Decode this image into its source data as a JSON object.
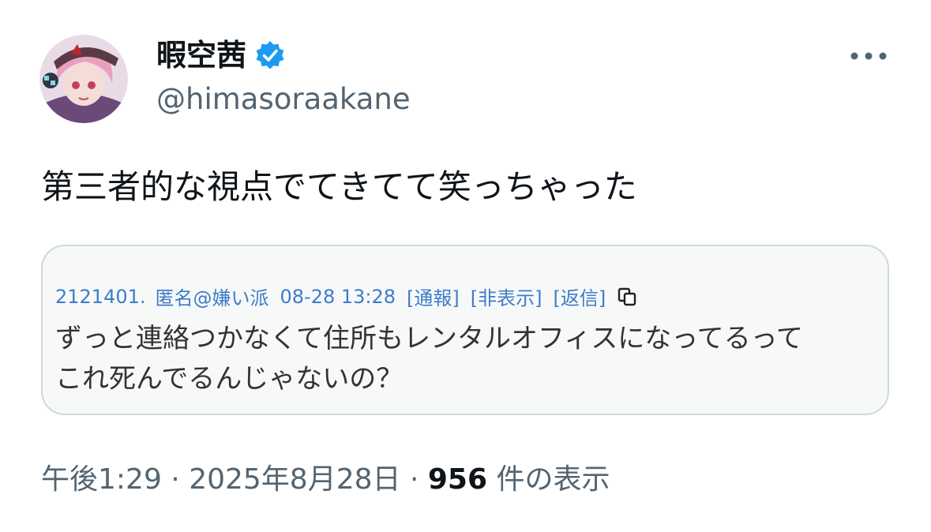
{
  "author": {
    "display_name": "暇空茜",
    "handle": "@himasoraakane",
    "verified_color": "#1d9bf0"
  },
  "tweet": {
    "text": "第三者的な視点でてきてて笑っちゃった"
  },
  "quote": {
    "post_number": "2121401.",
    "poster_name": "匿名@嫌い派",
    "datetime": "08-28 13:28",
    "report_link": "[通報]",
    "hide_link": "[非表示]",
    "reply_link": "[返信]",
    "body_line1": "ずっと連絡つかなくて住所もレンタルオフィスになってるって",
    "body_line2": "これ死んでるんじゃないの？"
  },
  "footer": {
    "time": "午後1:29",
    "separator1": " · ",
    "date": "2025年8月28日",
    "separator2": " · ",
    "views_count": "956",
    "views_label": " 件の表示"
  },
  "icons": {
    "more": "more-horizontal-icon",
    "verified": "verified-badge-icon",
    "copy": "copy-icon"
  }
}
